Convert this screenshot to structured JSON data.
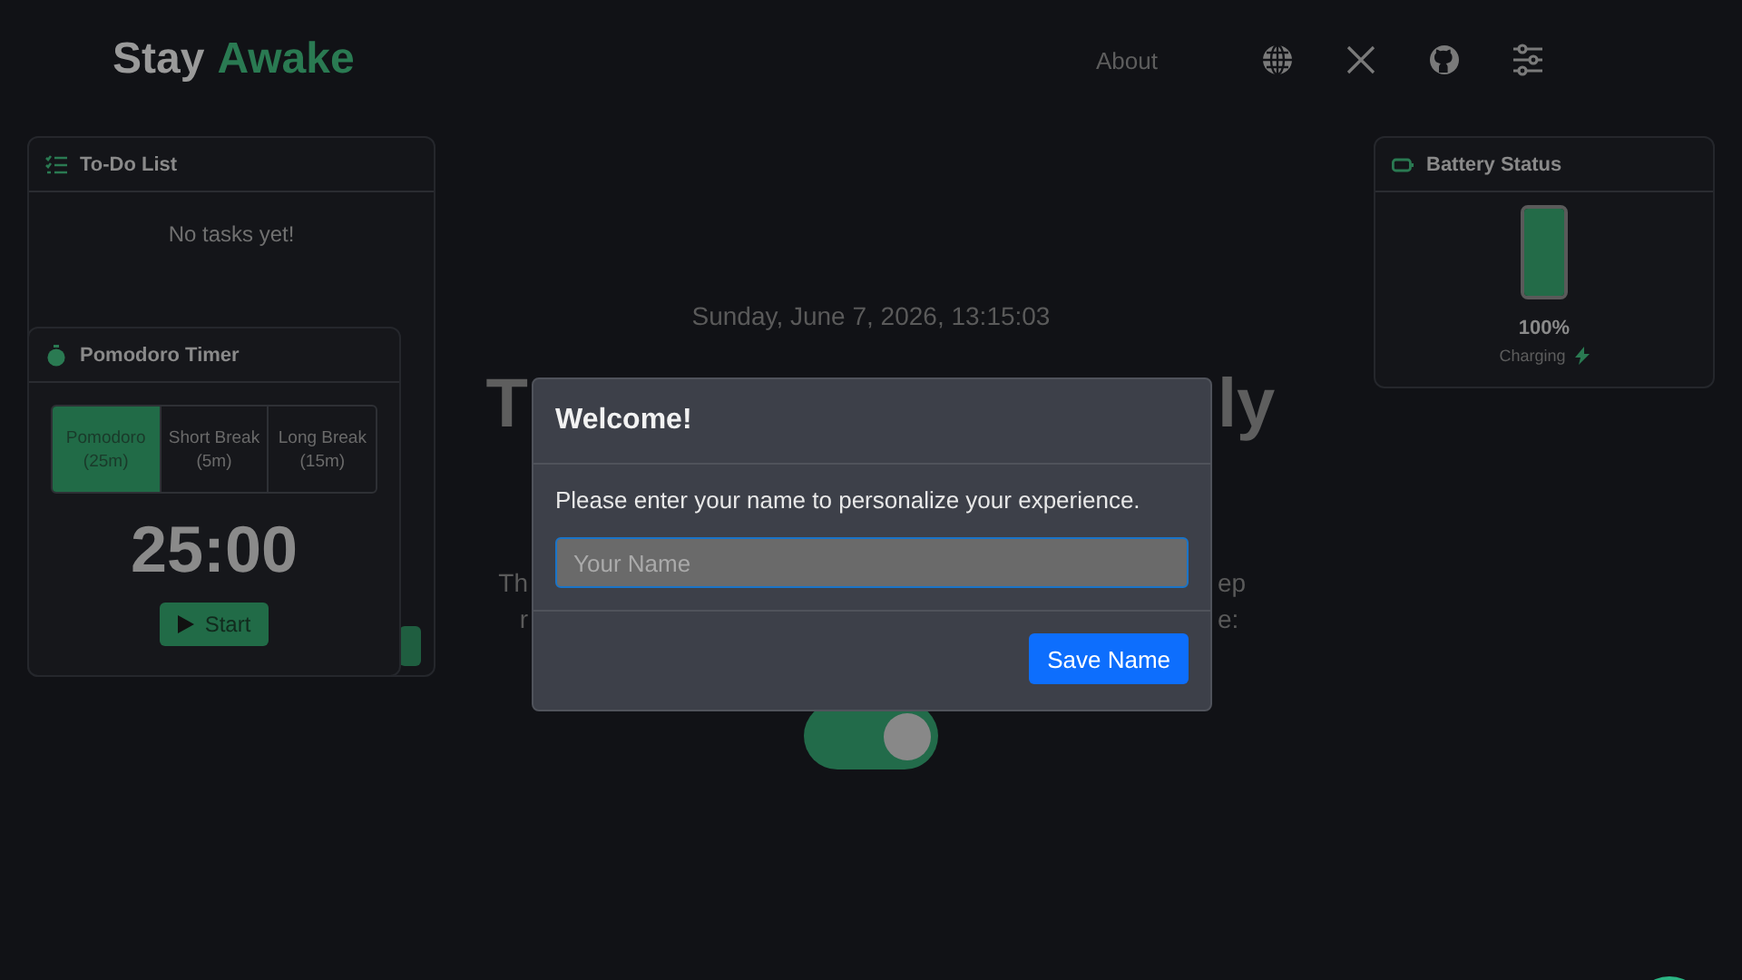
{
  "header": {
    "logo": [
      "Stay",
      "Awake"
    ],
    "nav": {
      "label": "About"
    }
  },
  "todo": {
    "title": "To-Do List",
    "empty_text": "No tasks yet!"
  },
  "pomodoro": {
    "title": "Pomodoro Timer",
    "time": "25:00",
    "start": "Start",
    "modes": [
      {
        "label": "Pomodoro (25m)",
        "selected": true
      },
      {
        "label": "Short Break (5m)",
        "selected": false
      },
      {
        "label": "Long Break (15m)",
        "selected": false
      }
    ]
  },
  "battery": {
    "title": "Battery Status",
    "level": 1,
    "percent": "100%",
    "status": "Charging"
  },
  "main": {
    "date": "Sunday, June 7, 2026, 13:15:03",
    "heading_fragments": [
      "T",
      "ly"
    ],
    "text_lines": [
      [
        "Th",
        "ep"
      ],
      [
        "r",
        "e:"
      ]
    ],
    "toggle": {
      "on": true
    }
  },
  "modal": {
    "title": "Welcome!",
    "message": "Please enter your name to personalize your experience.",
    "placeholder": "Your Name",
    "button": "Save Name"
  }
}
